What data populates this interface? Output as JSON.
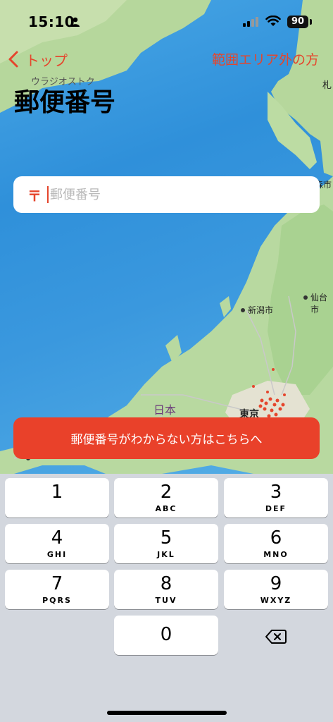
{
  "status_bar": {
    "time": "15:10",
    "battery": "90",
    "icons": [
      "person-icon",
      "signal-icon",
      "wifi-icon",
      "battery-icon"
    ]
  },
  "nav": {
    "back_label": "トップ",
    "right_link": "範囲エリア外の方"
  },
  "page": {
    "title": "郵便番号"
  },
  "map": {
    "labels": {
      "vladivostok": "ウラジオストク",
      "sapporo": "札",
      "aomori": "森市",
      "sendai": "仙台市",
      "niigata": "新潟市",
      "japan": "日本",
      "tokyo": "東京"
    },
    "colors": {
      "sea": "#2f90da",
      "land": "#b9dba4",
      "markers": "#e5452c"
    }
  },
  "postal_input": {
    "mark": "〒",
    "placeholder": "郵便番号",
    "value": ""
  },
  "help_button": {
    "label": "郵便番号がわからない方はこちらへ"
  },
  "keypad": {
    "keys": [
      {
        "digit": "1",
        "letters": ""
      },
      {
        "digit": "2",
        "letters": "ABC"
      },
      {
        "digit": "3",
        "letters": "DEF"
      },
      {
        "digit": "4",
        "letters": "GHI"
      },
      {
        "digit": "5",
        "letters": "JKL"
      },
      {
        "digit": "6",
        "letters": "MNO"
      },
      {
        "digit": "7",
        "letters": "PQRS"
      },
      {
        "digit": "8",
        "letters": "TUV"
      },
      {
        "digit": "9",
        "letters": "WXYZ"
      },
      {
        "digit": "0",
        "letters": ""
      }
    ],
    "delete_icon": "delete-backspace-icon"
  },
  "accent_color": "#e5452c"
}
